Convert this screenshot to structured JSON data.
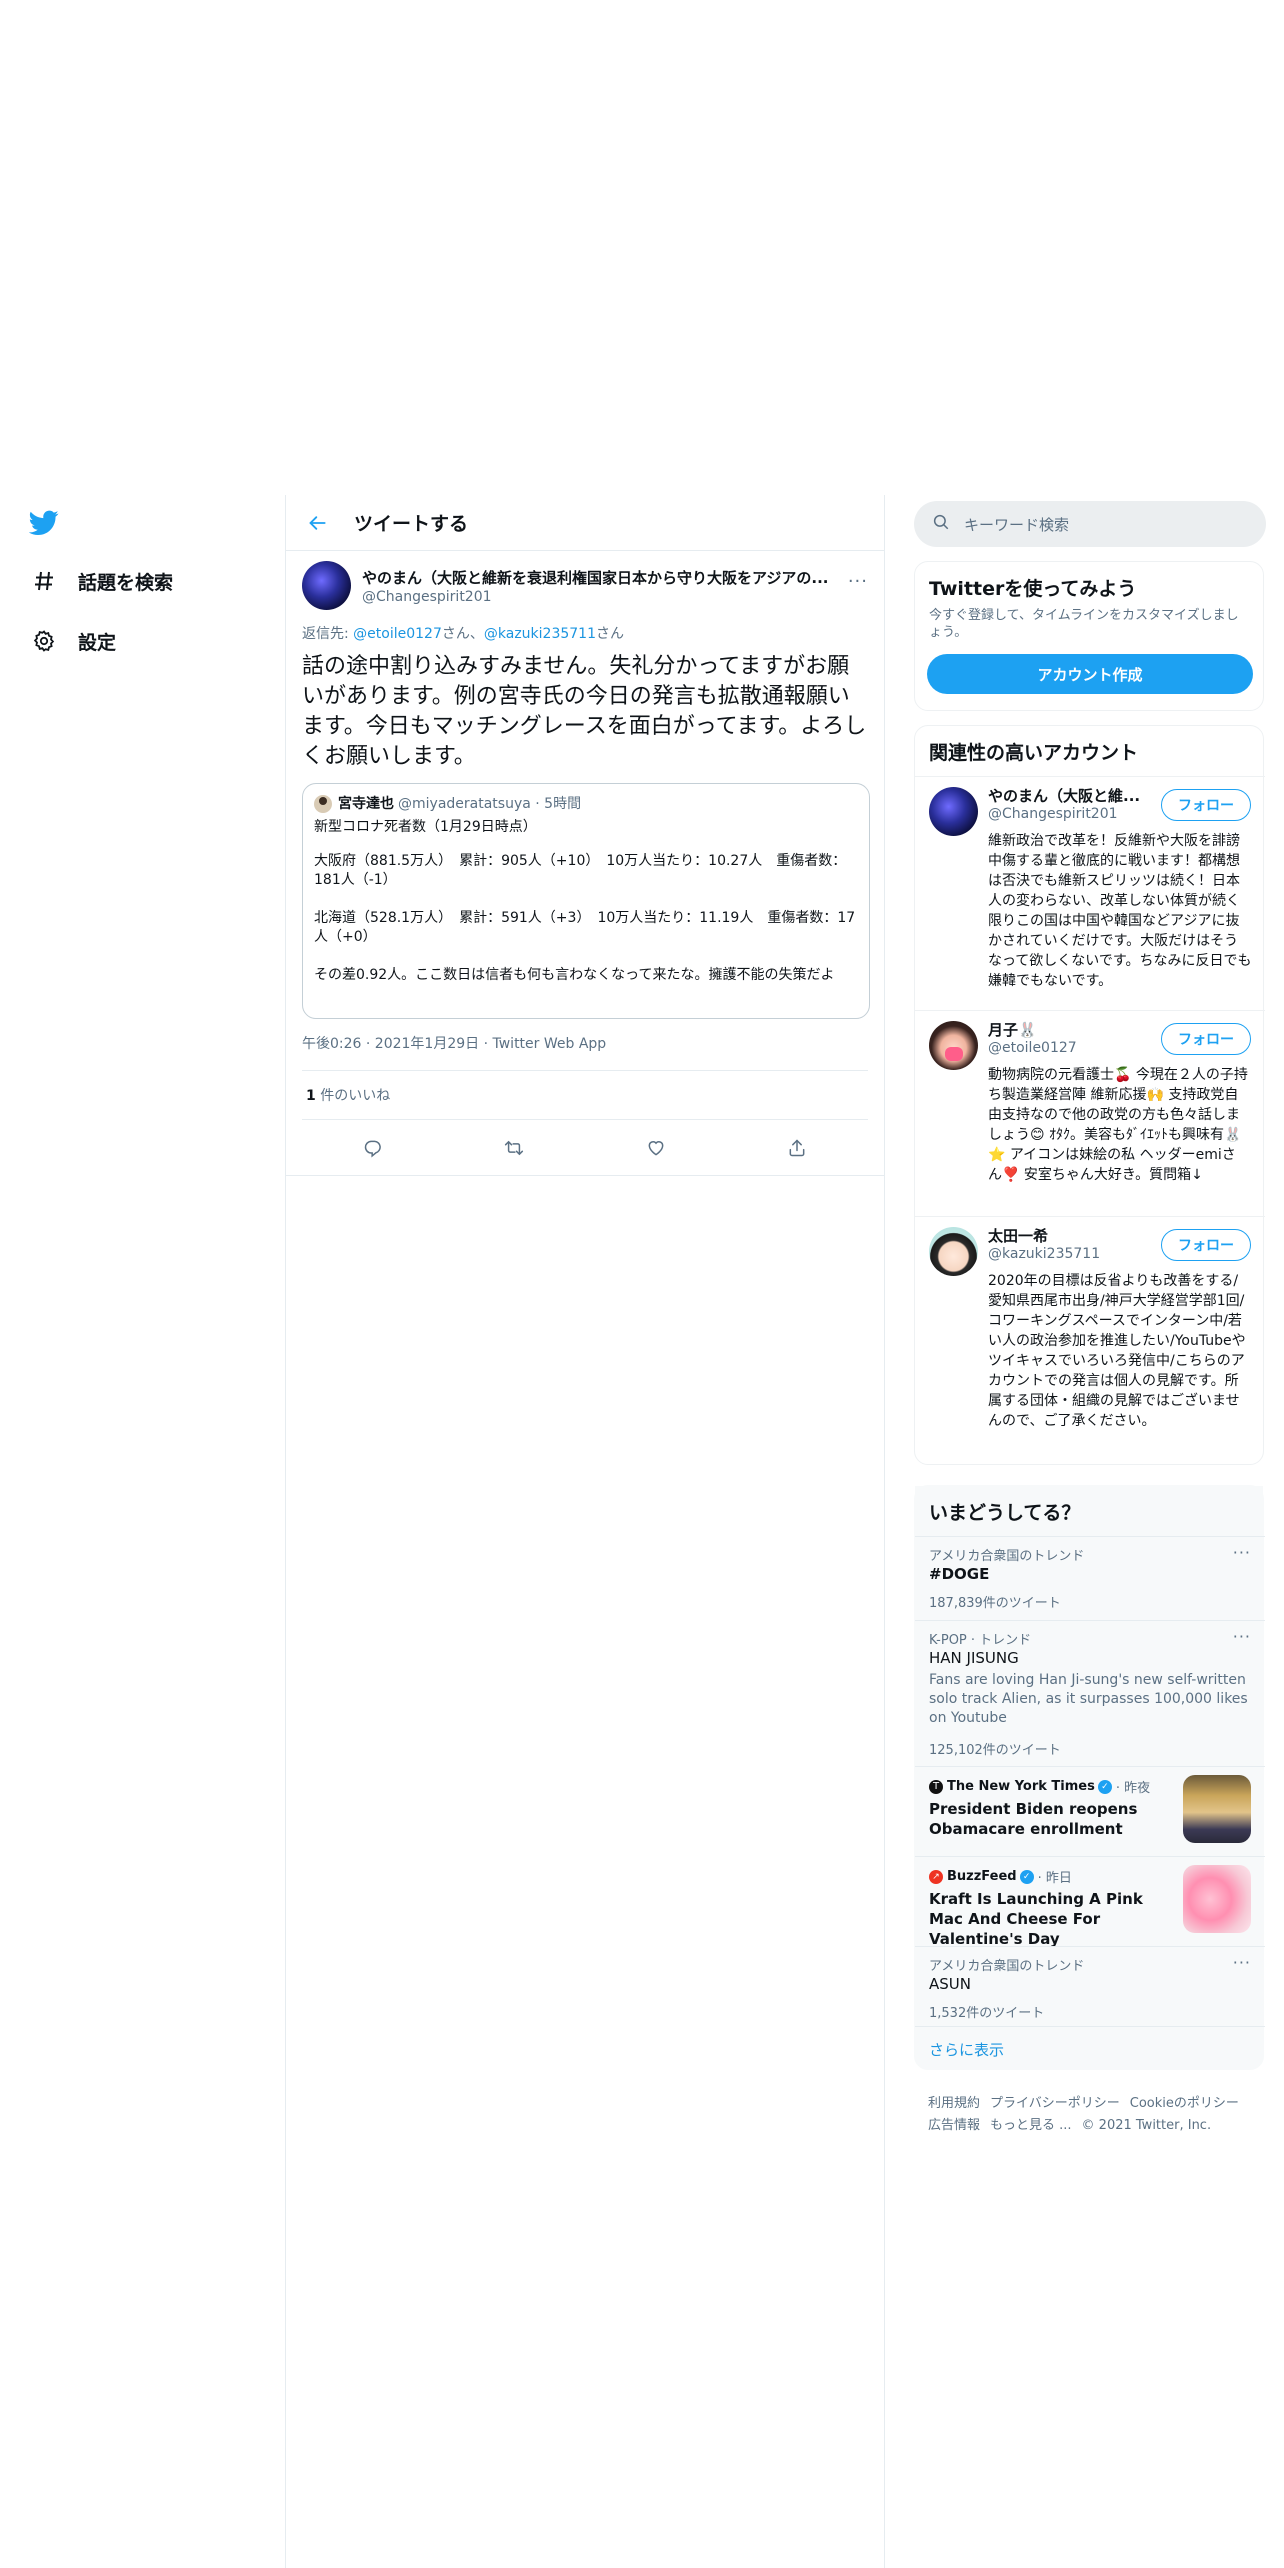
{
  "nav": {
    "items": [
      {
        "label": "話題を検索"
      },
      {
        "label": "設定"
      }
    ]
  },
  "header": {
    "title": "ツイートする"
  },
  "tweet": {
    "name": "やのまん（大阪と維新を衰退利権国家日本から守り大阪をアジアの...",
    "handle": "@Changespirit201",
    "reply_prefix": "返信先: ",
    "reply_user1": "@etoile0127",
    "reply_san1": "さん、",
    "reply_user2": "@kazuki235711",
    "reply_san2": "さん",
    "text": "話の途中割り込みすみません。失礼分かってますがお願いがあります。例の宮寺氏の今日の発言も拡散通報願います。今日もマッチングレースを面白がってます。よろしくお願いします。",
    "meta": "午後0:26 · 2021年1月29日 · Twitter Web App",
    "likes_count": "1",
    "likes_label": " 件のいいね"
  },
  "quote": {
    "name": "宮寺達也",
    "handle_time": "@miyaderatatsuya · 5時間",
    "line1": "新型コロナ死者数（1月29日時点）",
    "line2": "大阪府（881.5万人）　累計：905人（+10）　10万人当たり：10.27人　重傷者数：181人（-1）",
    "line3": "北海道（528.1万人）　累計：591人（+3）　10万人当たり：11.19人　重傷者数：17人（+0）",
    "line4": "その差0.92人。ここ数日は信者も何も言わなくなって来たな。擁護不能の失策だよ"
  },
  "search": {
    "placeholder": "キーワード検索"
  },
  "signup": {
    "title": "Twitterを使ってみよう",
    "desc": "今すぐ登録して、タイムラインをカスタマイズしましょう。",
    "button": "アカウント作成"
  },
  "related": {
    "title": "関連性の高いアカウント",
    "follow_label": "フォロー",
    "accounts": [
      {
        "name": "やのまん（大阪と維...",
        "handle": "@Changespirit201",
        "bio": "維新政治で改革を！反維新や大阪を誹謗中傷する輩と徹底的に戦います！都構想は否決でも維新スピリッツは続く！日本人の変わらない、改革しない体質が続く限りこの国は中国や韓国などアジアに抜かされていくだけです。大阪だけはそうなって欲しくないです。ちなみに反日でも嫌韓でもないです。"
      },
      {
        "name": "月子🐰",
        "handle": "@etoile0127",
        "bio": "動物病院の元看護士🍒 今現在２人の子持ち製造業経営陣 維新応援🙌 支持政党自由支持なので他の政党の方も色々話しましょう😊 ｵﾀｸ。美容もﾀﾞｲｴｯﾄも興味有🐰⭐ アイコンは妹絵の私 ヘッダーemiさん❣️ 安室ちゃん大好き。質問箱↓"
      },
      {
        "name": "太田一希",
        "handle": "@kazuki235711",
        "bio": "2020年の目標は反省よりも改善をする/愛知県西尾市出身/神戸大学経営学部1回/コワーキングスペースでインターン中/若い人の政治参加を推進したい/YouTubeやツイキャスでいろいろ発信中/こちらのアカウントでの発言は個人の見解です。所属する団体・組織の見解ではございませんので、ご了承ください。"
      }
    ]
  },
  "trends": {
    "title": "いまどうしてる？",
    "items": [
      {
        "context": "アメリカ合衆国のトレンド",
        "name": "#DOGE",
        "count": "187,839件のツイート"
      },
      {
        "context": "K-POP · トレンド",
        "name": "HAN JISUNG",
        "desc": "Fans are loving Han Ji-sung's new self-written solo track Alien, as it surpasses 100,000 likes on Youtube",
        "count": "125,102件のツイート"
      },
      {
        "source": "The New York Times",
        "time": "· 昨夜",
        "title": "President Biden reopens Obamacare enrollment"
      },
      {
        "source": "BuzzFeed",
        "time": "· 昨日",
        "title": "Kraft Is Launching A Pink Mac And Cheese For Valentine's Day"
      },
      {
        "context": "アメリカ合衆国のトレンド",
        "name": "ASUN",
        "count": "1,532件のツイート"
      }
    ],
    "show_more": "さらに表示"
  },
  "footer": {
    "links": [
      "利用規約",
      "プライバシーポリシー",
      "Cookieのポリシー",
      "広告情報",
      "もっと見る ...",
      "© 2021 Twitter, Inc."
    ]
  },
  "colors": {
    "accent": "#1da1f2",
    "link": "#1b95e0",
    "muted": "#5b7083"
  }
}
